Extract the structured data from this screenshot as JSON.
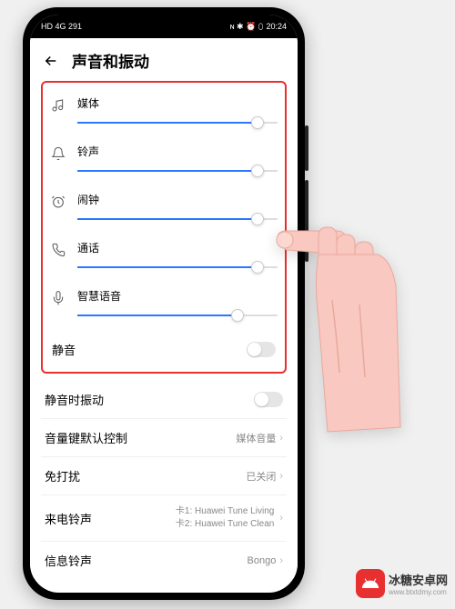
{
  "status_bar": {
    "time": "20:24",
    "left_indicators": "HD 4G 291",
    "right_indicators": "ɴ ✱ ⏰ ⬯"
  },
  "header": {
    "title": "声音和振动"
  },
  "sliders": {
    "media": {
      "label": "媒体",
      "value": 90
    },
    "ringtone": {
      "label": "铃声",
      "value": 90
    },
    "alarm": {
      "label": "闹钟",
      "value": 90
    },
    "call": {
      "label": "通话",
      "value": 90
    },
    "voice": {
      "label": "智慧语音",
      "value": 80
    }
  },
  "settings": {
    "mute": {
      "label": "静音",
      "enabled": false
    },
    "vibrate_on_mute": {
      "label": "静音时振动",
      "enabled": false
    },
    "volume_key": {
      "label": "音量键默认控制",
      "value": "媒体音量"
    },
    "dnd": {
      "label": "免打扰",
      "value": "已关闭"
    },
    "incoming_ringtone": {
      "label": "来电铃声",
      "line1": "卡1: Huawei Tune Living",
      "line2": "卡2: Huawei Tune Clean"
    },
    "sms_ringtone": {
      "label": "信息铃声",
      "value": "Bongo"
    }
  },
  "watermark": {
    "name": "冰糖安卓网",
    "url": "www.btxtdmy.com"
  }
}
